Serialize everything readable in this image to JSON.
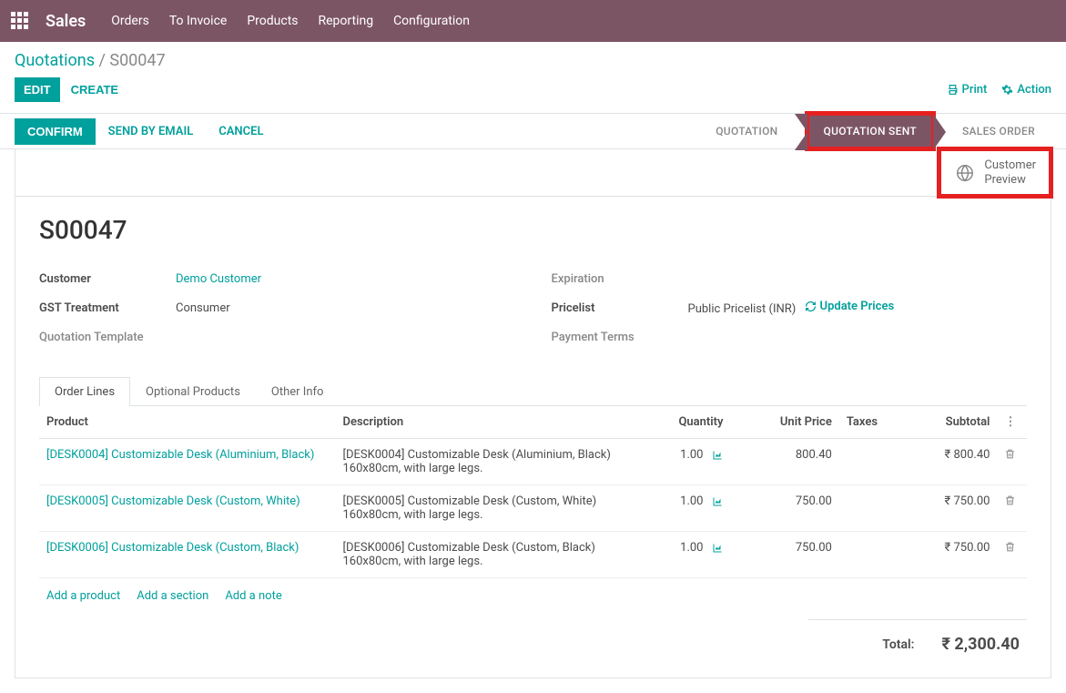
{
  "nav": {
    "app": "Sales",
    "items": [
      "Orders",
      "To Invoice",
      "Products",
      "Reporting",
      "Configuration"
    ]
  },
  "breadcrumb": {
    "root": "Quotations",
    "leaf": "S00047"
  },
  "toolbar": {
    "edit": "EDIT",
    "create": "CREATE",
    "print": "Print",
    "action": "Action"
  },
  "actionbar": {
    "confirm": "CONFIRM",
    "send_email": "SEND BY EMAIL",
    "cancel": "CANCEL"
  },
  "status_steps": {
    "quotation": "QUOTATION",
    "quotation_sent": "QUOTATION SENT",
    "sales_order": "SALES ORDER"
  },
  "customer_preview": {
    "line1": "Customer",
    "line2": "Preview"
  },
  "record": {
    "title": "S00047",
    "customer_lbl": "Customer",
    "customer_val": "Demo Customer",
    "gst_lbl": "GST Treatment",
    "gst_val": "Consumer",
    "tmpl_lbl": "Quotation Template",
    "tmpl_val": "",
    "exp_lbl": "Expiration",
    "exp_val": "",
    "pricelist_lbl": "Pricelist",
    "pricelist_val": "Public Pricelist (INR)",
    "update_prices": "Update Prices",
    "payment_lbl": "Payment Terms",
    "payment_val": ""
  },
  "tabs": {
    "order_lines": "Order Lines",
    "optional": "Optional Products",
    "other": "Other Info"
  },
  "columns": {
    "product": "Product",
    "description": "Description",
    "qty": "Quantity",
    "unit_price": "Unit Price",
    "taxes": "Taxes",
    "subtotal": "Subtotal"
  },
  "lines": [
    {
      "product": "[DESK0004] Customizable Desk (Aluminium, Black)",
      "description": "[DESK0004] Customizable Desk (Aluminium, Black) 160x80cm, with large legs.",
      "qty": "1.00",
      "unit_price": "800.40",
      "taxes": "",
      "subtotal": "₹ 800.40"
    },
    {
      "product": "[DESK0005] Customizable Desk (Custom, White)",
      "description": "[DESK0005] Customizable Desk (Custom, White) 160x80cm, with large legs.",
      "qty": "1.00",
      "unit_price": "750.00",
      "taxes": "",
      "subtotal": "₹ 750.00"
    },
    {
      "product": "[DESK0006] Customizable Desk (Custom, Black)",
      "description": "[DESK0006] Customizable Desk (Custom, Black) 160x80cm, with large legs.",
      "qty": "1.00",
      "unit_price": "750.00",
      "taxes": "",
      "subtotal": "₹ 750.00"
    }
  ],
  "add": {
    "product": "Add a product",
    "section": "Add a section",
    "note": "Add a note"
  },
  "totals": {
    "label": "Total:",
    "amount": "₹  2,300.40"
  }
}
